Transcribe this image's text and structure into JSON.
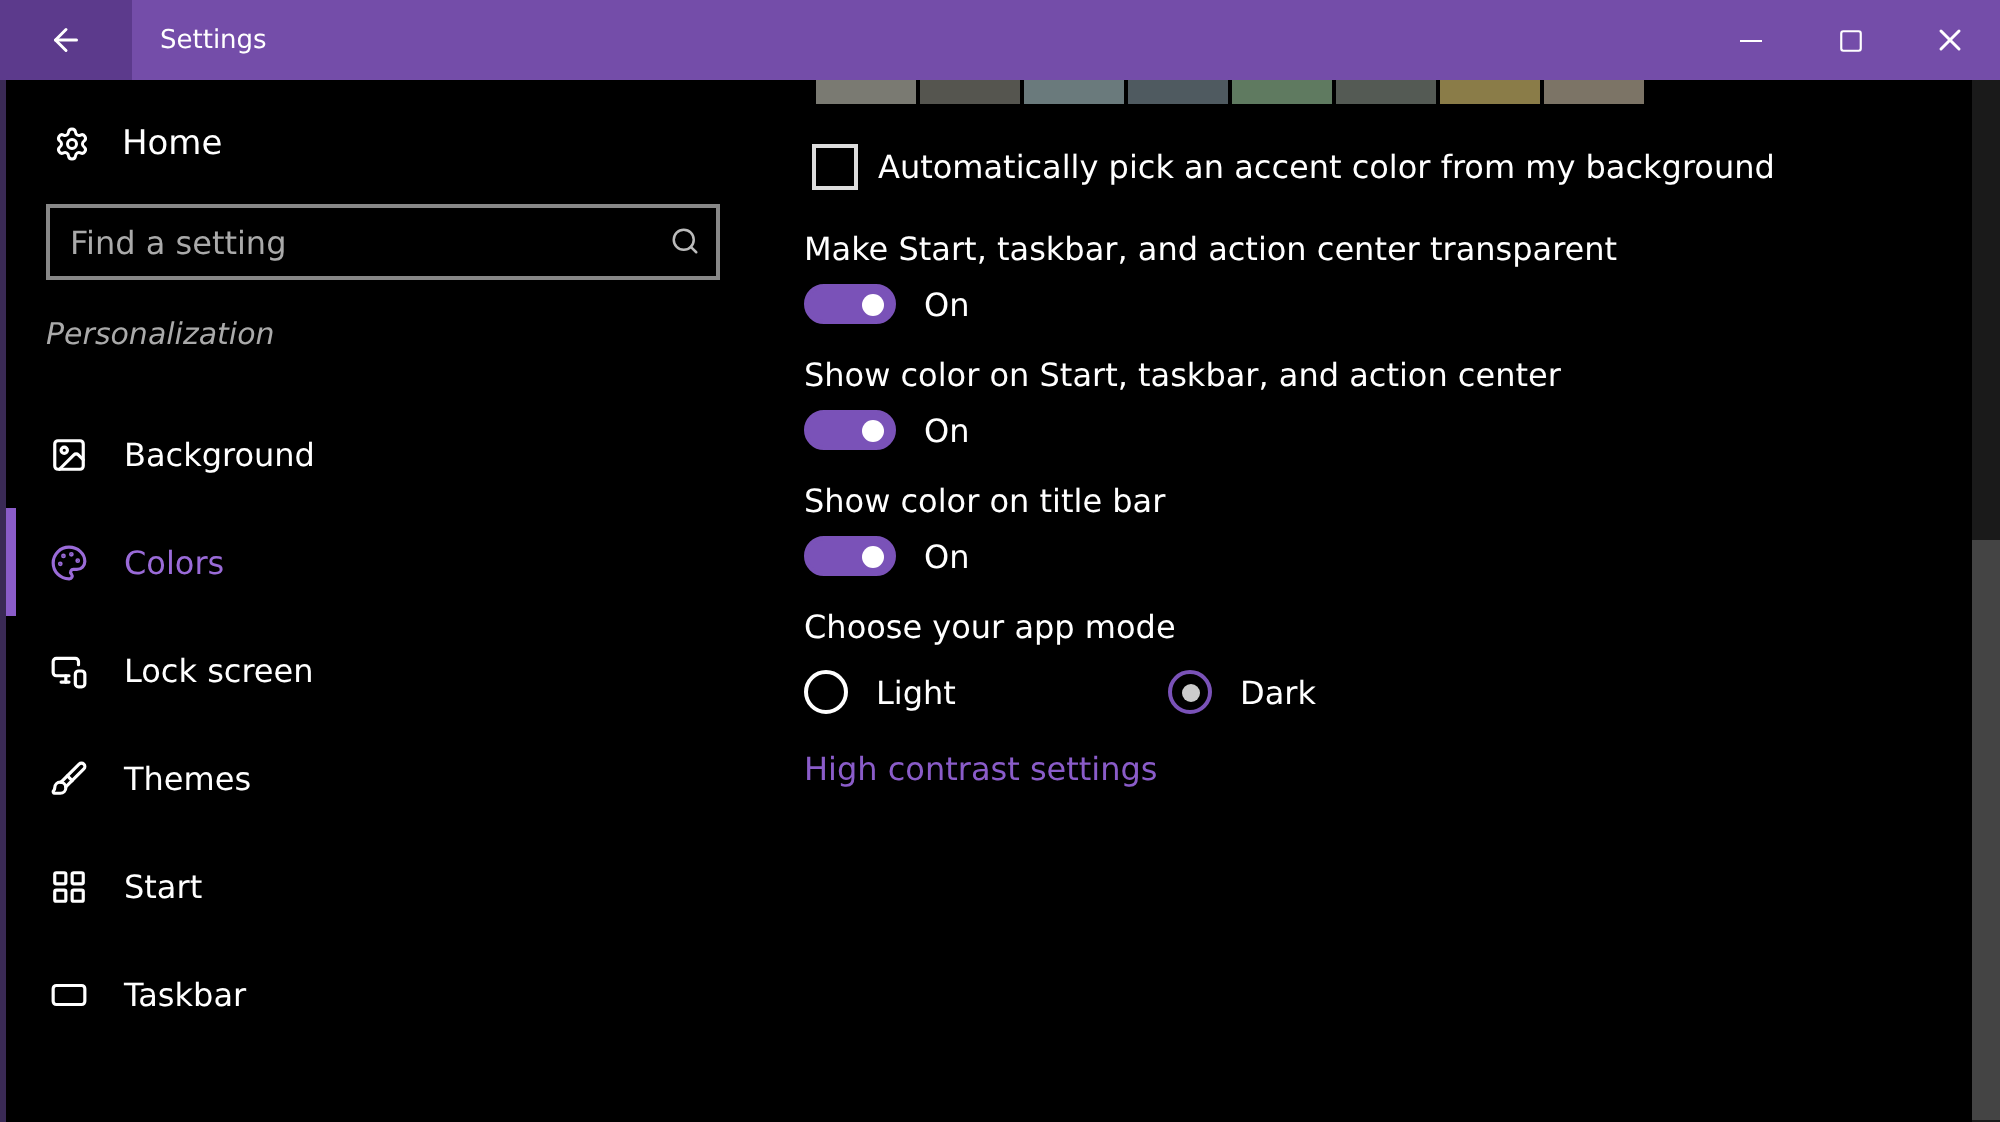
{
  "window": {
    "title": "Settings"
  },
  "sidebar": {
    "home": "Home",
    "search": {
      "placeholder": "Find a setting"
    },
    "section": "Personalization",
    "items": [
      {
        "label": "Background",
        "selected": false
      },
      {
        "label": "Colors",
        "selected": true
      },
      {
        "label": "Lock screen",
        "selected": false
      },
      {
        "label": "Themes",
        "selected": false
      },
      {
        "label": "Start",
        "selected": false
      },
      {
        "label": "Taskbar",
        "selected": false
      }
    ]
  },
  "swatches": [
    {
      "color": "#7a7a72"
    },
    {
      "color": "#55554f"
    },
    {
      "color": "#6a7a7c"
    },
    {
      "color": "#4f5a60"
    },
    {
      "color": "#5f7a60"
    },
    {
      "color": "#545a54"
    },
    {
      "color": "#8a7c48"
    },
    {
      "color": "#7c7466"
    }
  ],
  "auto_accent": {
    "label": "Automatically pick an accent color from my background",
    "checked": false
  },
  "toggles": [
    {
      "label": "Make Start, taskbar, and action center transparent",
      "on": true,
      "state": "On"
    },
    {
      "label": "Show color on Start, taskbar, and action center",
      "on": true,
      "state": "On"
    },
    {
      "label": "Show color on title bar",
      "on": true,
      "state": "On"
    }
  ],
  "app_mode": {
    "label": "Choose your app mode",
    "options": [
      {
        "label": "Light",
        "selected": false
      },
      {
        "label": "Dark",
        "selected": true
      }
    ]
  },
  "link": "High contrast settings"
}
